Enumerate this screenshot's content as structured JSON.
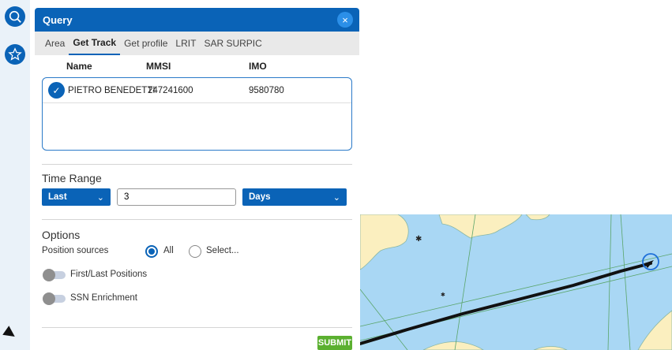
{
  "panel": {
    "title": "Query",
    "close_glyph": "×"
  },
  "tabs": [
    "Area",
    "Get Track",
    "Get profile",
    "LRIT",
    "SAR SURPIC"
  ],
  "active_tab": "Get Track",
  "results": {
    "columns": [
      "Name",
      "MMSI",
      "IMO"
    ],
    "rows": [
      {
        "selected": true,
        "name": "PIETRO BENEDETTI",
        "mmsi": "247241600",
        "imo": "9580780"
      }
    ],
    "check_glyph": "✓"
  },
  "time_range": {
    "title": "Time Range",
    "mode": "Last",
    "value": "3",
    "unit": "Days",
    "chevron": "⌄"
  },
  "options": {
    "title": "Options",
    "position_sources_label": "Position sources",
    "radio_all": "All",
    "radio_select": "Select...",
    "selected_source": "All",
    "toggle_first_last": "First/Last Positions",
    "toggle_ssn": "SSN Enrichment",
    "first_last_on": false,
    "ssn_on": false
  },
  "submit_label": "SUBMIT",
  "icons": {
    "rail_top": "search-globe-icon",
    "rail_second": "star-icon",
    "rail_bottom": "collapse-arrow-icon",
    "map_target": "target-circle-icon"
  },
  "colors": {
    "brand": "#0a63b7",
    "tab_bar": "#e9e9e9",
    "submit": "#5bb030",
    "sea": "#a9d7f4",
    "land": "#fbefbf",
    "track": "#111111"
  }
}
